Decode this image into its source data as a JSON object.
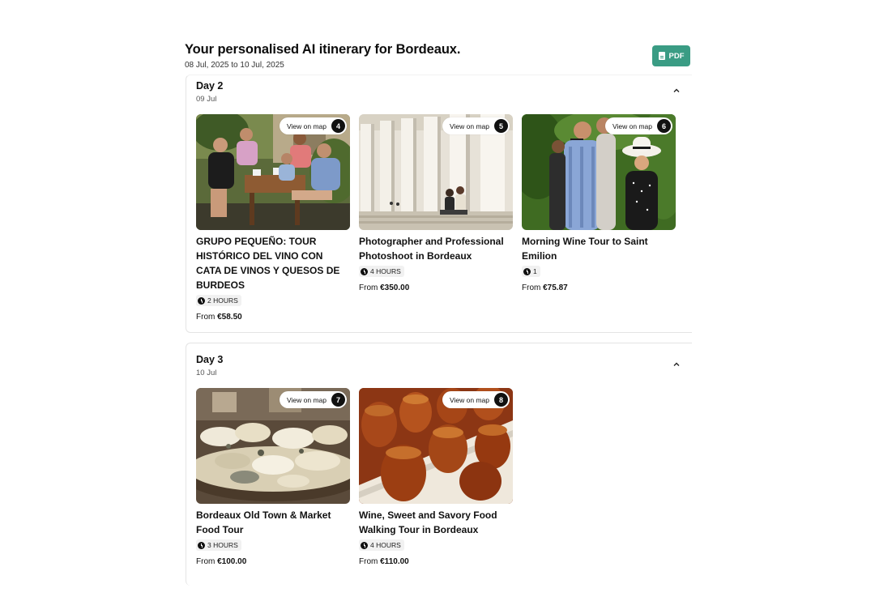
{
  "header": {
    "title": "Your personalised AI itinerary for Bordeaux.",
    "dates": "08 Jul, 2025 to 10 Jul, 2025"
  },
  "pdf_button": {
    "label": "PDF"
  },
  "colors": {
    "accent": "#3a9c84",
    "badge": "#111111"
  },
  "days": [
    {
      "label": "Day 2",
      "date": "09 Jul",
      "tours": [
        {
          "map_label": "View on map",
          "number": "4",
          "name": "GRUPO PEQUEÑO: TOUR HISTÓRICO DEL VINO CON CATA DE VINOS Y QUESOS DE BURDEOS",
          "duration": "2 HOURS",
          "price_prefix": "From",
          "price": "€58.50",
          "image": "outdoor-wine-tasting-group-photo"
        },
        {
          "map_label": "View on map",
          "number": "5",
          "name": "Photographer and Professional Photoshoot in Bordeaux",
          "duration": "4 HOURS",
          "price_prefix": "From",
          "price": "€350.00",
          "image": "couple-under-colonnade-photo"
        },
        {
          "map_label": "View on map",
          "number": "6",
          "name": "Morning Wine Tour to Saint Emilion",
          "duration": "1",
          "price_prefix": "From",
          "price": "€75.87",
          "image": "people-in-vineyard-photo"
        }
      ]
    },
    {
      "label": "Day 3",
      "date": "10 Jul",
      "tours": [
        {
          "map_label": "View on map",
          "number": "7",
          "name": "Bordeaux Old Town & Market Food Tour",
          "duration": "3 HOURS",
          "price_prefix": "From",
          "price": "€100.00",
          "image": "cheese-platter-photo"
        },
        {
          "map_label": "View on map",
          "number": "8",
          "name": "Wine, Sweet and Savory Food Walking Tour in Bordeaux",
          "duration": "4 HOURS",
          "price_prefix": "From",
          "price": "€110.00",
          "image": "caneles-pastries-photo"
        }
      ]
    }
  ]
}
